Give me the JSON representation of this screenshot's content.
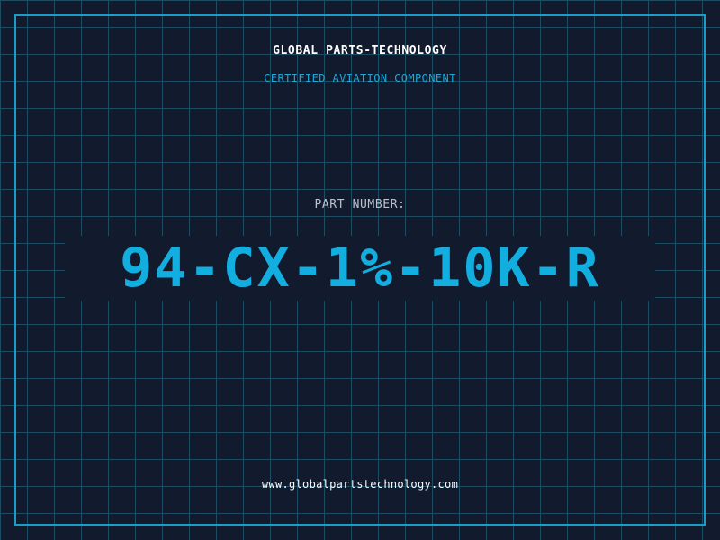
{
  "header": {
    "brand": "GLOBAL PARTS-TECHNOLOGY",
    "subtitle": "CERTIFIED AVIATION COMPONENT"
  },
  "part": {
    "label": "PART NUMBER:",
    "number": "94-CX-1%-10K-R"
  },
  "footer": {
    "website": "www.globalpartstechnology.com"
  },
  "colors": {
    "background": "#121a2e",
    "grid": "#1d4d63",
    "accent": "#1a9cc8",
    "part_number": "#13aee0"
  }
}
